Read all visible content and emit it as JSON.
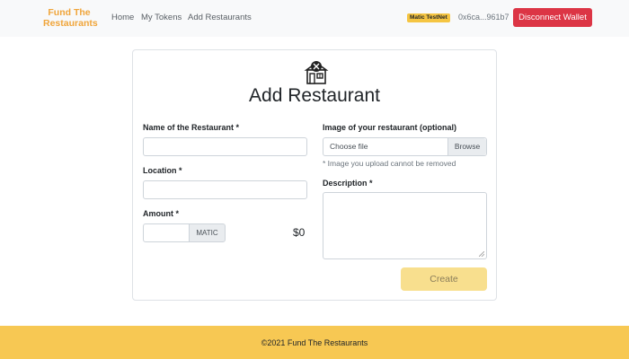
{
  "navbar": {
    "brand": "Fund The\nRestaurants",
    "links": [
      "Home",
      "My Tokens",
      "Add Restaurants"
    ],
    "network_badge": "Matic TestNet",
    "address": "0x6ca...961b7",
    "disconnect_label": "Disconnect Wallet"
  },
  "form": {
    "logo_icon": "restaurant-building-icon",
    "title": "Add Restaurant",
    "name_label": "Name of the Restaurant *",
    "name_value": "",
    "location_label": "Location *",
    "location_value": "",
    "amount_label": "Amount *",
    "amount_value": "",
    "amount_unit": "MATIC",
    "amount_display": "$0",
    "image_label": "Image of your restaurant (optional)",
    "file_placeholder": "Choose file",
    "browse_label": "Browse",
    "image_note": "* Image you upload cannot be removed",
    "description_label": "Description *",
    "description_value": "",
    "create_label": "Create"
  },
  "footer": {
    "text": "©2021 Fund The Restaurants"
  },
  "colors": {
    "brand": "#f0a53a",
    "accent": "#f7c853",
    "danger": "#dc3545"
  }
}
